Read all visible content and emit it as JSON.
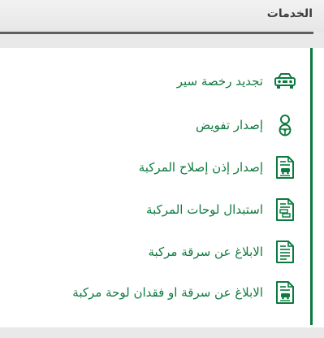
{
  "header": {
    "title": "الخدمات"
  },
  "colors": {
    "accent": "#0b7a3e",
    "text": "#0f7a3f",
    "header_text": "#3d3d3d"
  },
  "services": [
    {
      "label": "تجديد رخصة سير",
      "icon": "car-icon"
    },
    {
      "label": "إصدار تفويض",
      "icon": "driver-icon"
    },
    {
      "label": "إصدار إذن إصلاح المركبة",
      "icon": "document-car-icon"
    },
    {
      "label": "استبدال لوحات المركبة",
      "icon": "document-plates-icon"
    },
    {
      "label": "الابلاغ عن سرقة مركبة",
      "icon": "document-icon"
    },
    {
      "label": "الابلاغ عن سرقة او فقدان لوحة مركبة",
      "icon": "document-car-icon"
    }
  ]
}
